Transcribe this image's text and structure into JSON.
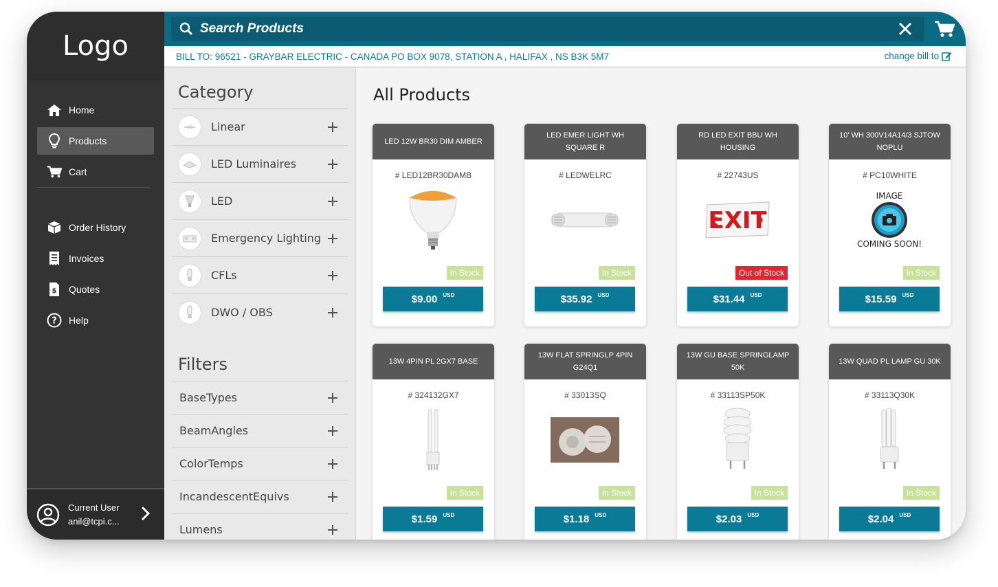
{
  "sidebar": {
    "logo": "Logo",
    "nav_main": [
      {
        "label": "Home",
        "icon": "home-icon"
      },
      {
        "label": "Products",
        "icon": "lightbulb-icon"
      },
      {
        "label": "Cart",
        "icon": "cart-icon"
      }
    ],
    "nav_secondary": [
      {
        "label": "Order History",
        "icon": "box-icon"
      },
      {
        "label": "Invoices",
        "icon": "receipt-icon"
      },
      {
        "label": "Quotes",
        "icon": "quote-document-icon"
      },
      {
        "label": "Help",
        "icon": "help-circle-icon"
      }
    ],
    "active_item": "Products",
    "user": {
      "label": "Current User",
      "email": "anil@tcpi.c..."
    }
  },
  "search": {
    "placeholder": "Search Products",
    "value": ""
  },
  "bill": {
    "text": "BILL TO: 96521 - GRAYBAR ELECTRIC - CANADA PO BOX 9078, STATION A , HALIFAX , NS B3K 5M7",
    "change_label": "change bill to"
  },
  "category": {
    "title": "Category",
    "items": [
      {
        "label": "Linear"
      },
      {
        "label": "LED Luminaires"
      },
      {
        "label": "LED"
      },
      {
        "label": "Emergency Lighting"
      },
      {
        "label": "CFLs"
      },
      {
        "label": "DWO / OBS"
      }
    ]
  },
  "filters": {
    "title": "Filters",
    "items": [
      {
        "label": "BaseTypes"
      },
      {
        "label": "BeamAngles"
      },
      {
        "label": "ColorTemps"
      },
      {
        "label": "IncandescentEquivs"
      },
      {
        "label": "Lumens"
      }
    ]
  },
  "products": {
    "title": "All Products",
    "currency": "USD",
    "items": [
      {
        "name": "LED 12W BR30 DIM AMBER",
        "sku": "# LED12BR30DAMB",
        "stock": "In Stock",
        "price": "$9.00"
      },
      {
        "name": "LED EMER LIGHT WH SQUARE R",
        "sku": "# LEDWELRC",
        "stock": "In Stock",
        "price": "$35.92"
      },
      {
        "name": "RD LED EXIT BBU WH HOUSING",
        "sku": "# 22743US",
        "stock": "Out of Stock",
        "price": "$31.44"
      },
      {
        "name": "10' WH 300V14A14/3 SJTOW NOPLU",
        "sku": "# PC10WHITE",
        "stock": "In Stock",
        "price": "$15.59"
      },
      {
        "name": "13W 4PIN PL 2GX7 BASE",
        "sku": "# 324132GX7",
        "stock": "In Stock",
        "price": "$1.59"
      },
      {
        "name": "13W FLAT SPRINGLP 4PIN G24Q1",
        "sku": "# 33013SQ",
        "stock": "In Stock",
        "price": "$1.18"
      },
      {
        "name": "13W GU BASE SPRINGLAMP 50K",
        "sku": "# 33113SP50K",
        "stock": "In Stock",
        "price": "$2.03"
      },
      {
        "name": "13W QUAD PL LAMP GU 30K",
        "sku": "# 33113Q30K",
        "stock": "In Stock",
        "price": "$2.04"
      }
    ],
    "placeholder_image": {
      "line1": "IMAGE",
      "line2": "COMING SOON!"
    },
    "exit_sign_text": "EXIT"
  },
  "colors": {
    "accent": "#0a7a97",
    "sidebar": "#333333",
    "in_stock": "#c8e29a",
    "out_of_stock": "#e0262e"
  }
}
